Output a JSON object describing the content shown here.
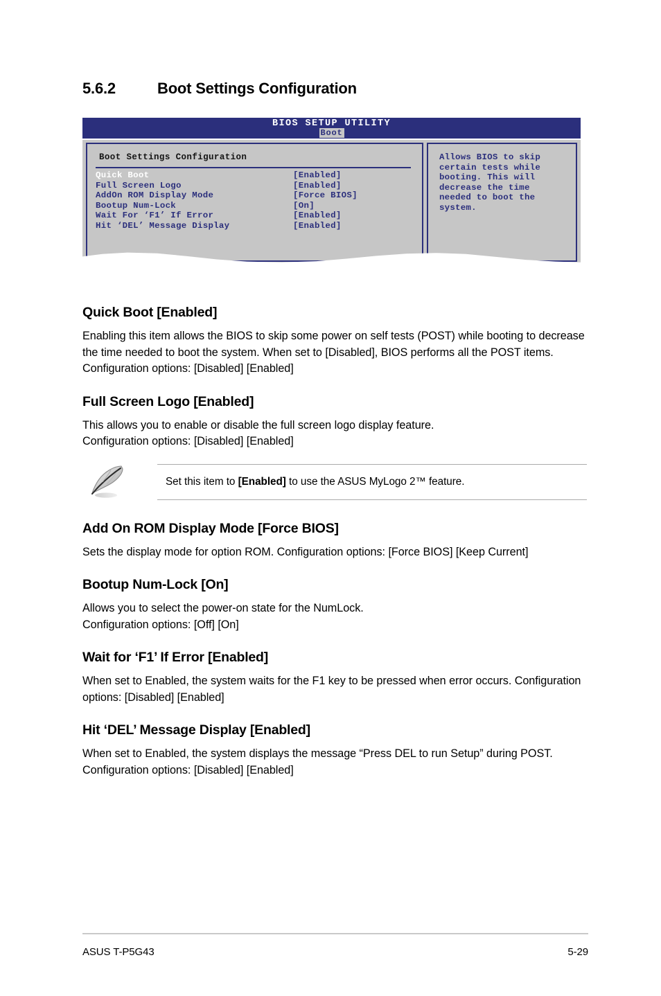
{
  "section": {
    "number": "5.6.2",
    "title": "Boot Settings Configuration"
  },
  "bios_screenshot": {
    "title": "BIOS SETUP UTILITY",
    "active_tab": "Boot",
    "panel_title": "Boot Settings Configuration",
    "rows": [
      {
        "label": "Quick Boot",
        "value": "[Enabled]",
        "selected": true
      },
      {
        "label": "Full Screen Logo",
        "value": "[Enabled]",
        "selected": false
      },
      {
        "label": "AddOn ROM Display Mode",
        "value": "[Force BIOS]",
        "selected": false
      },
      {
        "label": "Bootup Num-Lock",
        "value": "[On]",
        "selected": false
      },
      {
        "label": "Wait For ‘F1’ If Error",
        "value": "[Enabled]",
        "selected": false
      },
      {
        "label": "Hit ‘DEL’ Message Display",
        "value": "[Enabled]",
        "selected": false
      }
    ],
    "help_text": "Allows BIOS to skip\ncertain tests while\nbooting. This will\ndecrease the time\nneeded to boot the\nsystem.",
    "colors": {
      "titlebar": "#2b2f7c",
      "panel_bg": "#c6c6c6",
      "text": "#2b2f7c",
      "selected_text": "#ffffff"
    }
  },
  "items": [
    {
      "heading": "Quick Boot [Enabled]",
      "body": "Enabling this item allows the BIOS to skip some power on self tests (POST) while booting to decrease the time needed to boot the system. When set to [Disabled], BIOS performs all the POST items. Configuration options: [Disabled] [Enabled]"
    },
    {
      "heading": "Full Screen Logo [Enabled]",
      "body": "This allows you to enable or disable the full screen logo display feature.\nConfiguration options: [Disabled] [Enabled]"
    },
    {
      "heading": "Add On ROM Display Mode [Force BIOS]",
      "body": "Sets the display mode for option ROM. Configuration options: [Force BIOS] [Keep Current]"
    },
    {
      "heading": "Bootup Num-Lock [On]",
      "body": "Allows you to select the power-on state for the NumLock.\nConfiguration options: [Off] [On]"
    },
    {
      "heading": "Wait for ‘F1’ If Error [Enabled]",
      "body": "When set to Enabled, the system waits for the F1 key to be pressed when error occurs. Configuration options: [Disabled] [Enabled]"
    },
    {
      "heading": "Hit ‘DEL’ Message Display [Enabled]",
      "body": "When set to Enabled, the system displays the message “Press DEL to run Setup” during POST. Configuration options: [Disabled] [Enabled]"
    }
  ],
  "note": {
    "icon": "pencil-note-icon",
    "prefix": "Set this item to ",
    "emphasis": "[Enabled]",
    "suffix": " to use the ASUS MyLogo 2™ feature."
  },
  "footer": {
    "left": "ASUS T-P5G43",
    "right": "5-29"
  }
}
